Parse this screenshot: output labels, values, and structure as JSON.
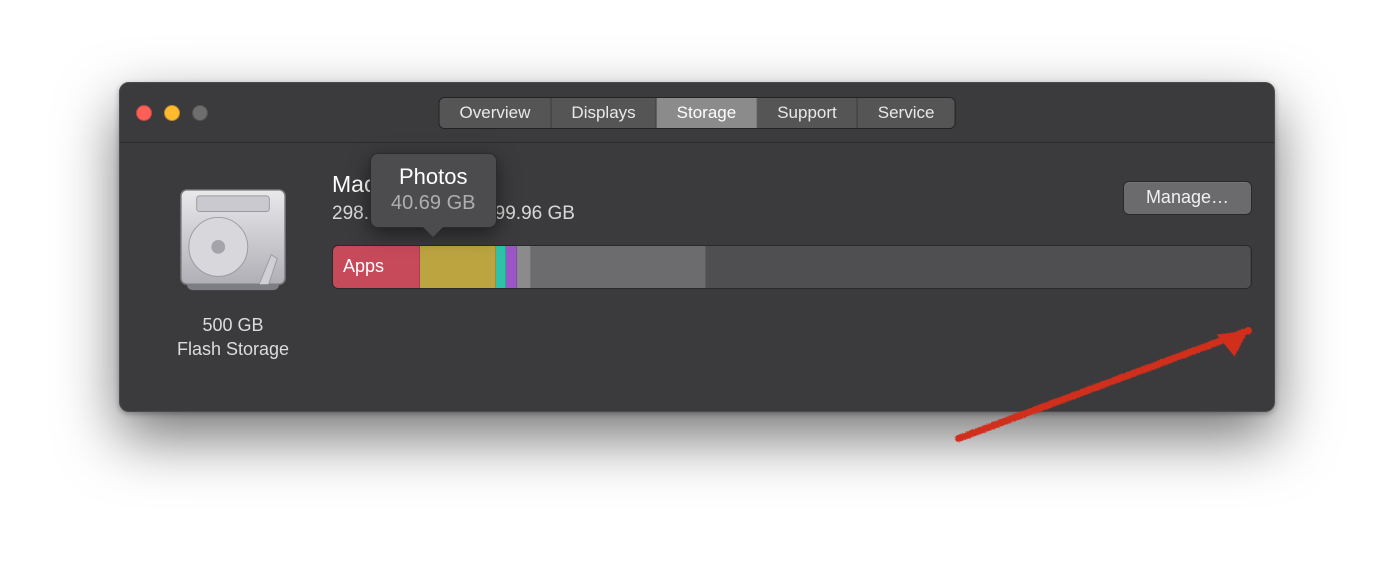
{
  "tabs": [
    {
      "label": "Overview",
      "active": false
    },
    {
      "label": "Displays",
      "active": false
    },
    {
      "label": "Storage",
      "active": true
    },
    {
      "label": "Support",
      "active": false
    },
    {
      "label": "Service",
      "active": false
    }
  ],
  "drive": {
    "capacity_line1": "500 GB",
    "capacity_line2": "Flash Storage",
    "name_visible": "Mac",
    "available_line": "298.. . .. . . .ble of 499.96 GB"
  },
  "manage_button": "Manage…",
  "tooltip": {
    "title": "Photos",
    "value": "40.69 GB"
  },
  "segments": [
    {
      "label": "Apps",
      "flex": 9.5,
      "color": "#c74a5a"
    },
    {
      "label": "",
      "flex": 8.3,
      "color": "#bca441"
    },
    {
      "label": "",
      "flex": 1.1,
      "color": "#2fc2aa"
    },
    {
      "label": "",
      "flex": 1.1,
      "color": "#9a55c6"
    },
    {
      "label": "",
      "flex": 1.6,
      "color": "#8b8b8d"
    },
    {
      "label": "",
      "flex": 19.0,
      "color": "#6c6c6e"
    },
    {
      "label": "",
      "flex": 59.4,
      "color": "#4f4f51"
    }
  ]
}
